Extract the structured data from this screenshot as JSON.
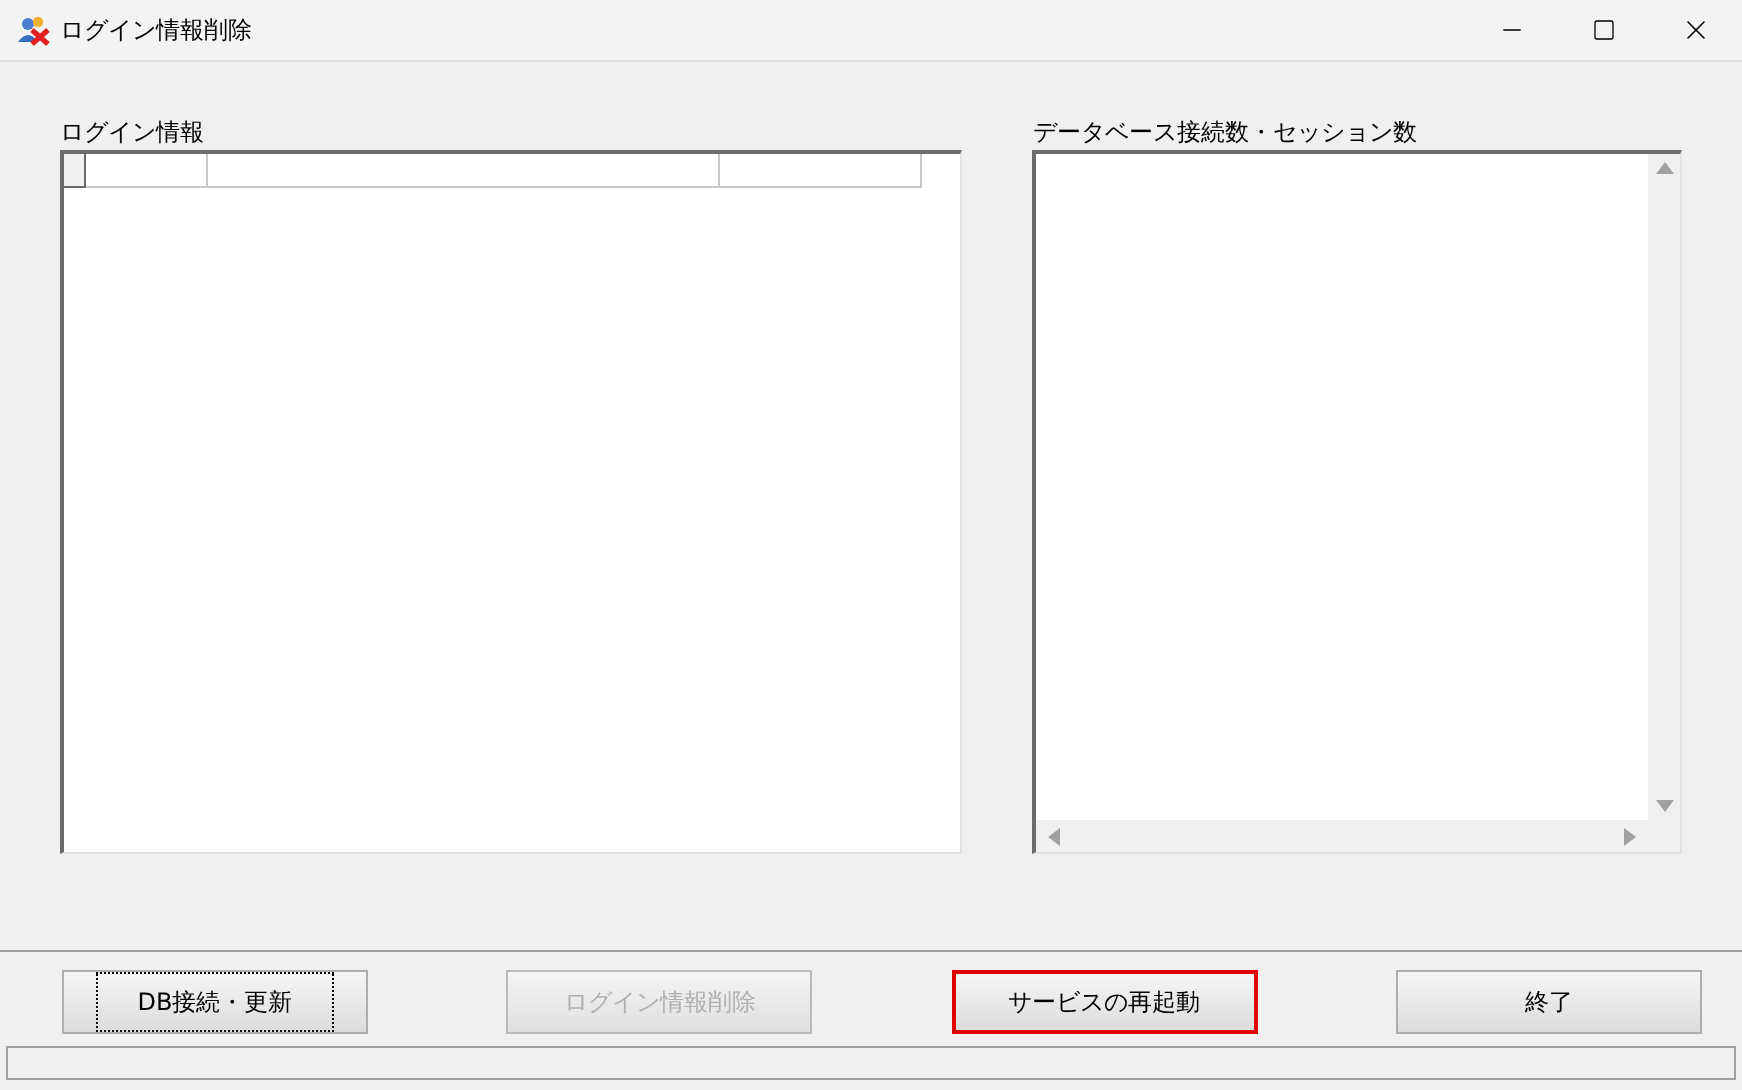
{
  "window": {
    "title": "ログイン情報削除"
  },
  "login_panel": {
    "label": "ログイン情報"
  },
  "db_panel": {
    "label": "データベース接続数・セッション数"
  },
  "buttons": [
    {
      "label": "DB接続・更新",
      "disabled": false,
      "focused": true,
      "highlighted": false
    },
    {
      "label": "ログイン情報削除",
      "disabled": true,
      "focused": false,
      "highlighted": false
    },
    {
      "label": "サービスの再起動",
      "disabled": false,
      "focused": false,
      "highlighted": true
    },
    {
      "label": "終了",
      "disabled": false,
      "focused": false,
      "highlighted": false
    }
  ]
}
